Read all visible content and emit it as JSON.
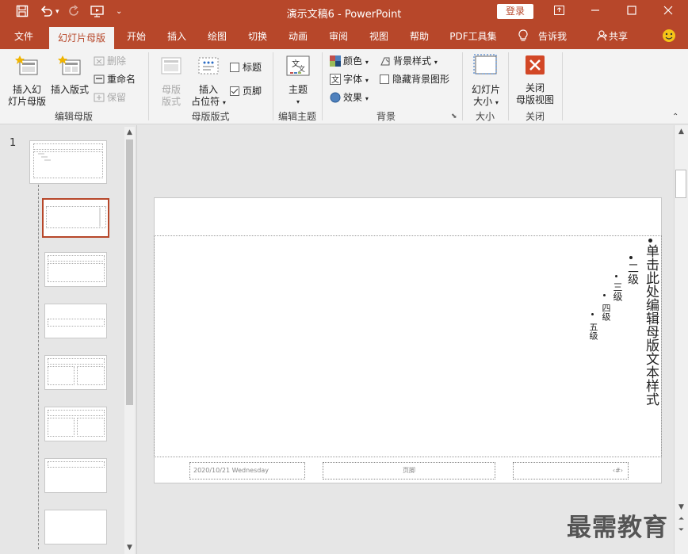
{
  "titlebar": {
    "title": "演示文稿6  -  PowerPoint",
    "login": "登录"
  },
  "tabs": [
    {
      "label": "文件"
    },
    {
      "label": "幻灯片母版"
    },
    {
      "label": "开始"
    },
    {
      "label": "插入"
    },
    {
      "label": "绘图"
    },
    {
      "label": "切换"
    },
    {
      "label": "动画"
    },
    {
      "label": "审阅"
    },
    {
      "label": "视图"
    },
    {
      "label": "帮助"
    },
    {
      "label": "PDF工具集"
    },
    {
      "label": "告诉我"
    },
    {
      "label": "共享"
    }
  ],
  "ribbon": {
    "edit_master": {
      "insert_slide_master_1": "插入幻",
      "insert_slide_master_2": "灯片母版",
      "insert_layout": "插入版式",
      "delete": "删除",
      "rename": "重命名",
      "preserve": "保留",
      "label": "编辑母版"
    },
    "master_layout": {
      "master_layout_1": "母版",
      "master_layout_2": "版式",
      "insert_placeholder_1": "插入",
      "insert_placeholder_2": "占位符",
      "title_chk": "标题",
      "footer_chk": "页脚",
      "label": "母版版式"
    },
    "edit_theme": {
      "theme": "主题",
      "label": "编辑主题"
    },
    "background": {
      "colors": "颜色",
      "fonts": "字体",
      "effects": "效果",
      "bg_styles": "背景样式",
      "hide_bg": "隐藏背景图形",
      "label": "背景"
    },
    "size": {
      "slide_size_1": "幻灯片",
      "slide_size_2": "大小",
      "label": "大小"
    },
    "close": {
      "close_1": "关闭",
      "close_2": "母版视图",
      "label": "关闭"
    }
  },
  "leftpane": {
    "slide_number": "1"
  },
  "slide": {
    "levels": [
      "单击此处编辑母版文本样式",
      "二级",
      "三级",
      "四级",
      "五级"
    ],
    "footer_date": "2020/10/21 Wednesday",
    "footer_center": "页脚",
    "footer_num": "‹#›"
  },
  "watermark": "最需教育",
  "colors": {
    "accent": "#b7472a",
    "ribbon_bg": "#f3f3f3"
  }
}
